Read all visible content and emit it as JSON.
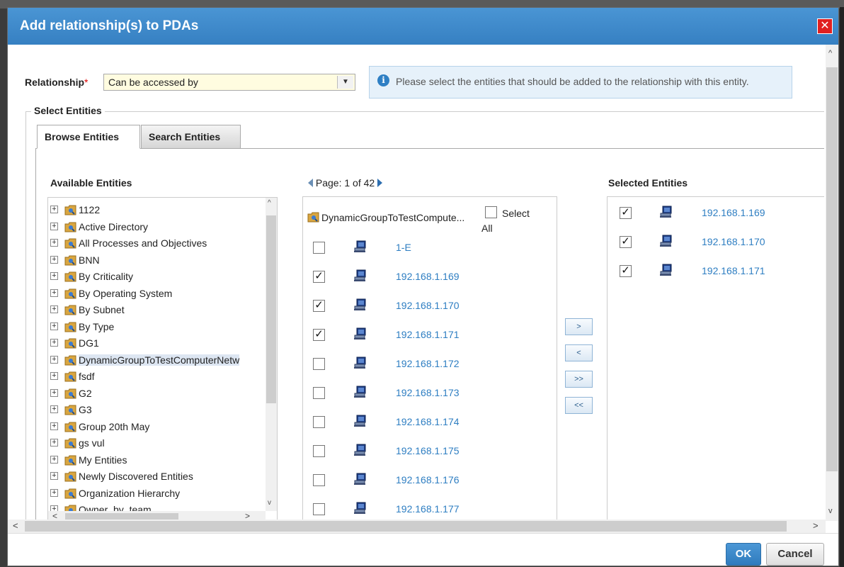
{
  "dialog": {
    "title": "Add relationship(s) to PDAs",
    "close_glyph": "✕"
  },
  "relationship": {
    "label": "Relationship",
    "required_mark": "*",
    "value": "Can be accessed by",
    "dropdown_glyph": "▼"
  },
  "info": {
    "icon": "info-icon",
    "glyph": "i",
    "text": "Please select the entities that should be added to the relationship with this entity."
  },
  "select_entities": {
    "legend": "Select Entities",
    "tabs": [
      {
        "label": "Browse Entities",
        "active": true
      },
      {
        "label": "Search Entities",
        "active": false
      }
    ]
  },
  "available": {
    "heading": "Available Entities",
    "expand_glyph": "+",
    "tree": [
      {
        "label": "1122"
      },
      {
        "label": "Active Directory"
      },
      {
        "label": "All Processes and Objectives"
      },
      {
        "label": "BNN"
      },
      {
        "label": "By Criticality"
      },
      {
        "label": "By Operating System"
      },
      {
        "label": "By Subnet"
      },
      {
        "label": "By Type"
      },
      {
        "label": "DG1"
      },
      {
        "label": "DynamicGroupToTestComputerNetw",
        "selected": true
      },
      {
        "label": "fsdf"
      },
      {
        "label": "G2"
      },
      {
        "label": "G3"
      },
      {
        "label": "Group 20th May"
      },
      {
        "label": "gs vul"
      },
      {
        "label": "My Entities"
      },
      {
        "label": "Newly Discovered Entities"
      },
      {
        "label": "Organization Hierarchy"
      },
      {
        "label": "Owner_by_team"
      }
    ],
    "scroll_glyphs": {
      "up": "^",
      "down": "v",
      "left": "<",
      "right": ">"
    }
  },
  "pager": {
    "text": "Page: 1 of 42",
    "current_page": 1,
    "total_pages": 42
  },
  "list": {
    "group_name": "DynamicGroupToTestCompute...",
    "select_all_line1": "Select",
    "select_all_line2": "All",
    "rows": [
      {
        "name": "1-E",
        "checked": false
      },
      {
        "name": "192.168.1.169",
        "checked": true
      },
      {
        "name": "192.168.1.170",
        "checked": true
      },
      {
        "name": "192.168.1.171",
        "checked": true
      },
      {
        "name": "192.168.1.172",
        "checked": false
      },
      {
        "name": "192.168.1.173",
        "checked": false
      },
      {
        "name": "192.168.1.174",
        "checked": false
      },
      {
        "name": "192.168.1.175",
        "checked": false
      },
      {
        "name": "192.168.1.176",
        "checked": false
      },
      {
        "name": "192.168.1.177",
        "checked": false
      }
    ],
    "check_glyph": "✓"
  },
  "move_buttons": {
    "add": ">",
    "remove": "<",
    "add_all": ">>",
    "remove_all": "<<"
  },
  "selected": {
    "heading": "Selected Entities",
    "rows": [
      {
        "name": "192.168.1.169",
        "checked": true
      },
      {
        "name": "192.168.1.170",
        "checked": true
      },
      {
        "name": "192.168.1.171",
        "checked": true
      }
    ]
  },
  "dialog_scroll_glyphs": {
    "up": "^",
    "down": "v",
    "left": "<",
    "right": ">"
  },
  "footer": {
    "ok_label": "OK",
    "cancel_label": "Cancel"
  },
  "colors": {
    "titlebar": "#3e89c9",
    "link": "#2e7ec2",
    "close": "#e02020",
    "select_bg": "#fffce0",
    "info_bg": "#e6f1fa"
  }
}
